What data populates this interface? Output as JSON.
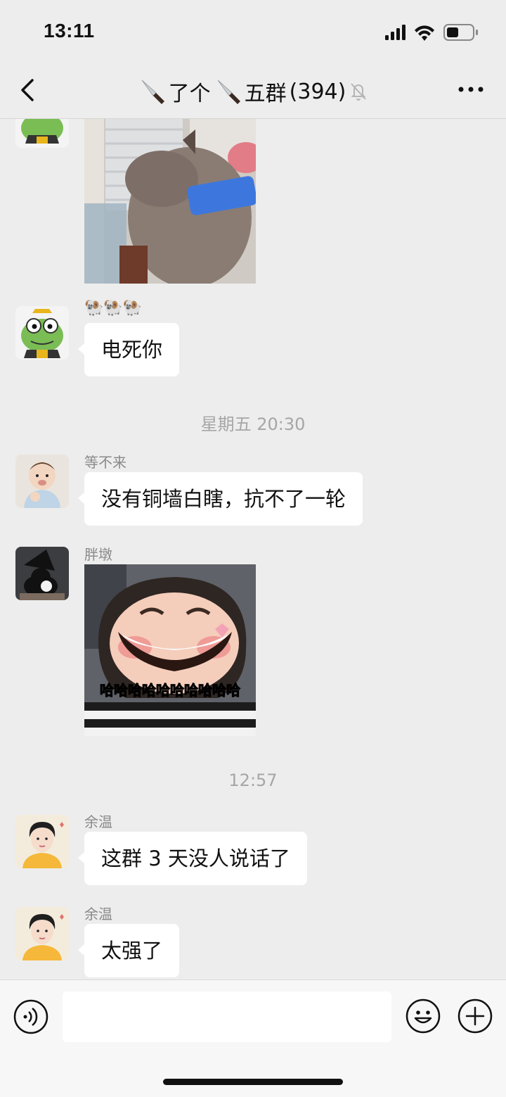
{
  "status_bar": {
    "time": "13:11"
  },
  "header": {
    "title_part1": "了个",
    "title_part2": "五群",
    "member_count": "(394)"
  },
  "messages": [
    {
      "type": "image",
      "sender": "",
      "description": "cat"
    },
    {
      "type": "text",
      "sender": "🐏🐏🐏",
      "text": "电死你"
    },
    {
      "type": "timestamp",
      "text": "星期五 20:30"
    },
    {
      "type": "text",
      "sender": "等不来",
      "text": "没有铜墙白瞎，抗不了一轮"
    },
    {
      "type": "image",
      "sender": "胖墩",
      "caption": "哈哈哈哈哈哈哈哈哈哈"
    },
    {
      "type": "timestamp",
      "text": "12:57"
    },
    {
      "type": "text",
      "sender": "余温",
      "text": "这群 3 天没人说话了"
    },
    {
      "type": "text",
      "sender": "余温",
      "text": "太强了"
    }
  ],
  "input": {
    "placeholder": ""
  },
  "colors": {
    "background": "#ededed",
    "bubble": "#ffffff",
    "meta_text": "#a6a6a6"
  }
}
